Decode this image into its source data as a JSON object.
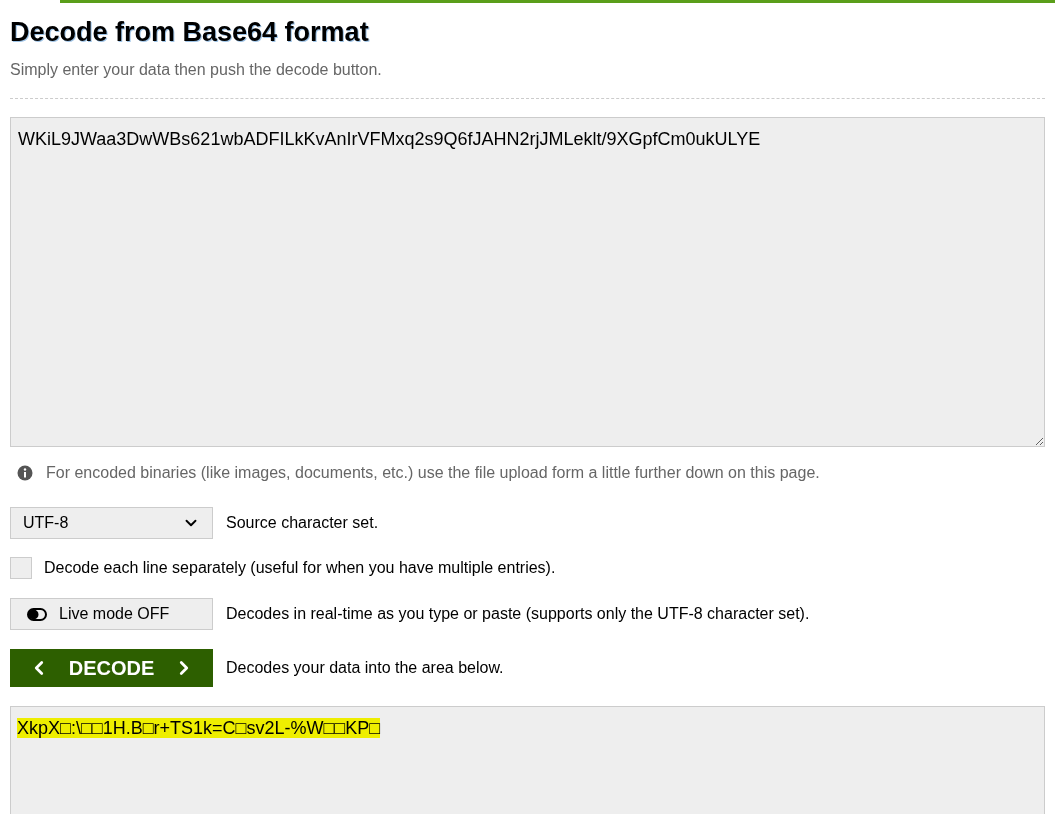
{
  "title": "Decode from Base64 format",
  "subtitle": "Simply enter your data then push the decode button.",
  "input": {
    "value": "WKiL9JWaa3DwWBs621wbADFILkKvAnIrVFMxq2s9Q6fJAHN2rjJMLeklt/9XGpfCm0ukULYE"
  },
  "info": "For encoded binaries (like images, documents, etc.) use the file upload form a little further down on this page.",
  "charset": {
    "value": "UTF-8",
    "label": "Source character set."
  },
  "line_option": {
    "label": "Decode each line separately (useful for when you have multiple entries).",
    "checked": false
  },
  "live_mode": {
    "label": "Live mode OFF",
    "on": false,
    "description": "Decodes in real-time as you type or paste (supports only the UTF-8 character set)."
  },
  "decode": {
    "label": "DECODE",
    "description": "Decodes your data into the area below."
  },
  "output": {
    "value": "XkpX□:\\□□1H.B□r+TS1k=C□sv2L-%W□□KP□",
    "highlighted": true
  }
}
